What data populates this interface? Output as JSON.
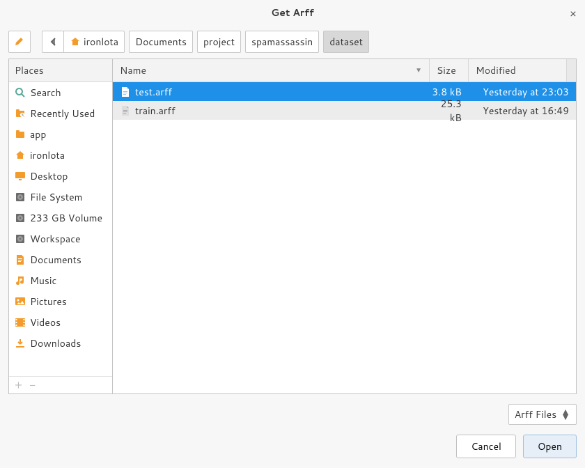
{
  "title": "Get Arff",
  "breadcrumbs": [
    {
      "label": "ironlota",
      "home": true
    },
    {
      "label": "Documents"
    },
    {
      "label": "project"
    },
    {
      "label": "spamassassin"
    },
    {
      "label": "dataset",
      "active": true
    }
  ],
  "sidebar": {
    "header": "Places",
    "items": [
      {
        "icon": "search",
        "label": "Search"
      },
      {
        "icon": "recent",
        "label": "Recently Used"
      },
      {
        "icon": "folder",
        "label": "app"
      },
      {
        "icon": "home",
        "label": "ironlota"
      },
      {
        "icon": "desktop",
        "label": "Desktop"
      },
      {
        "icon": "disk",
        "label": "File System"
      },
      {
        "icon": "disk",
        "label": "233 GB Volume"
      },
      {
        "icon": "disk",
        "label": "Workspace"
      },
      {
        "icon": "doc",
        "label": "Documents"
      },
      {
        "icon": "music",
        "label": "Music"
      },
      {
        "icon": "picture",
        "label": "Pictures"
      },
      {
        "icon": "video",
        "label": "Videos"
      },
      {
        "icon": "download",
        "label": "Downloads"
      }
    ]
  },
  "columns": {
    "name": "Name",
    "size": "Size",
    "modified": "Modified"
  },
  "files": [
    {
      "name": "test.arff",
      "size": "3.8 kB",
      "modified": "Yesterday at 23:03",
      "selected": true
    },
    {
      "name": "train.arff",
      "size": "25.3 kB",
      "modified": "Yesterday at 16:49",
      "selected": false
    }
  ],
  "filter": {
    "label": "Arff Files"
  },
  "buttons": {
    "cancel": "Cancel",
    "open": "Open"
  }
}
